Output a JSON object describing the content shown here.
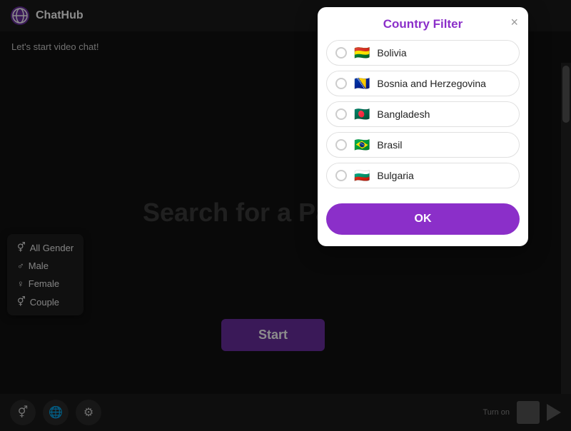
{
  "header": {
    "logo_alt": "ChatHub logo",
    "title": "ChatHub"
  },
  "main": {
    "lets_start": "Let's start video chat!",
    "search_text": "Search for a Par",
    "start_button": "Start"
  },
  "gender_menu": {
    "items": [
      {
        "icon": "⚥",
        "label": "All Gender"
      },
      {
        "icon": "♂",
        "label": "Male"
      },
      {
        "icon": "♀",
        "label": "Female"
      },
      {
        "icon": "⚥",
        "label": "Couple"
      }
    ]
  },
  "bottom_bar": {
    "icon1": "⚥",
    "icon2": "🌐",
    "icon3": "⚙",
    "turn_on": "Turn on"
  },
  "modal": {
    "title": "Country Filter",
    "close_label": "×",
    "ok_label": "OK",
    "countries": [
      {
        "flag": "🇧🇴",
        "name": "Bolivia"
      },
      {
        "flag": "🇧🇦",
        "name": "Bosnia and Herzegovina"
      },
      {
        "flag": "🇧🇩",
        "name": "Bangladesh"
      },
      {
        "flag": "🇧🇷",
        "name": "Brasil"
      },
      {
        "flag": "🇧🇬",
        "name": "Bulgaria"
      }
    ]
  }
}
